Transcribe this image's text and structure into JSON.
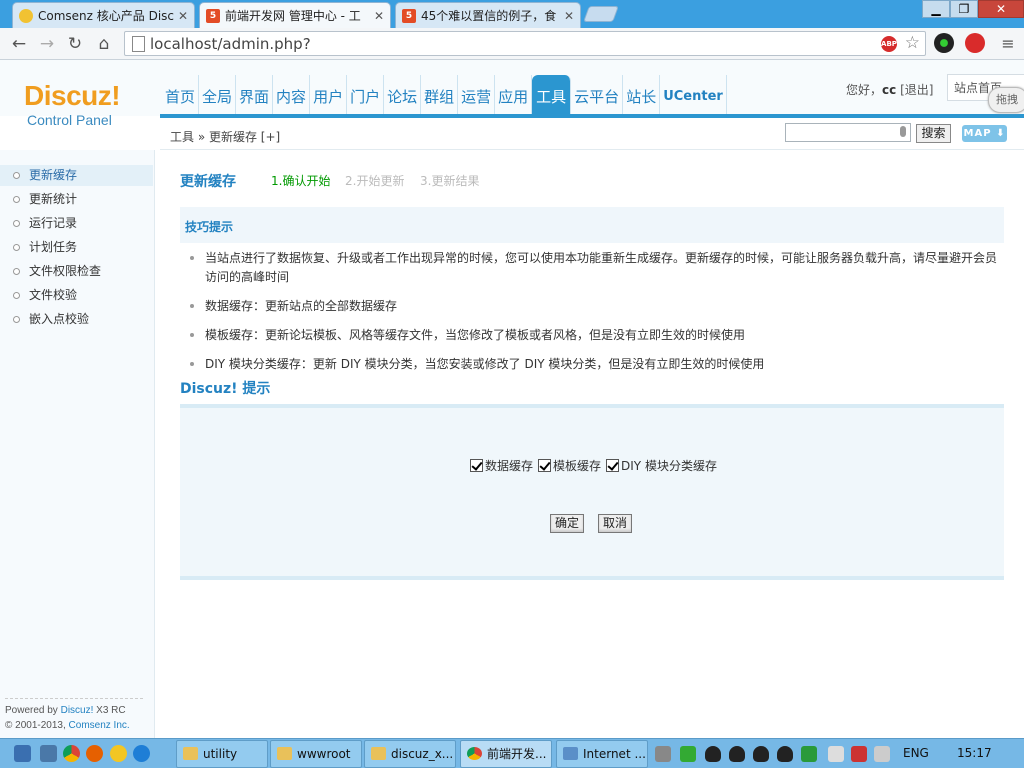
{
  "browser": {
    "tabs": [
      {
        "title": "Comsenz 核心产品 Discu",
        "icon": "comsenz-favicon"
      },
      {
        "title": "前端开发网 管理中心 - 工",
        "icon": "html5-favicon"
      },
      {
        "title": "45个难以置信的例子，食",
        "icon": "html5-favicon"
      }
    ],
    "close_glyph": "✕",
    "url": "localhost/admin.php?",
    "abp_label": "ABP"
  },
  "header": {
    "logo": "Discuz!",
    "logo_sub": "Control Panel",
    "nav": [
      "首页",
      "全局",
      "界面",
      "内容",
      "用户",
      "门户",
      "论坛",
      "群组",
      "运营",
      "应用",
      "工具",
      "云平台",
      "站长",
      "UCenter"
    ],
    "active_nav": "工具",
    "greeting_prefix": "您好，",
    "username": "cc",
    "logout": "[退出]",
    "site_home": "站点首页",
    "drag_label": "拖拽"
  },
  "subbar": {
    "breadcrumb": "工具 » 更新缓存  [+]",
    "search_button": "搜索",
    "map_button": "MAP"
  },
  "sidebar": {
    "items": [
      "更新缓存",
      "更新统计",
      "运行记录",
      "计划任务",
      "文件权限检查",
      "文件校验",
      "嵌入点校验"
    ],
    "active": "更新缓存"
  },
  "footer": {
    "powered_prefix": "Powered by ",
    "product": "Discuz!",
    "version": " X3 RC",
    "copyright_prefix": "© 2001-2013, ",
    "company": "Comsenz Inc."
  },
  "main": {
    "title": "更新缓存",
    "steps": [
      "1.确认开始",
      "2.开始更新",
      "3.更新结果"
    ],
    "tips_title": "技巧提示",
    "tips": [
      "当站点进行了数据恢复、升级或者工作出现异常的时候，您可以使用本功能重新生成缓存。更新缓存的时候，可能让服务器负载升高，请尽量避开会员访问的高峰时间",
      "数据缓存：更新站点的全部数据缓存",
      "模板缓存：更新论坛模板、风格等缓存文件，当您修改了模板或者风格，但是没有立即生效的时候使用",
      "DIY 模块分类缓存：更新 DIY 模块分类，当您安装或修改了 DIY 模块分类，但是没有立即生效的时候使用"
    ],
    "notice_title": "Discuz! 提示",
    "checkboxes": [
      {
        "label": "数据缓存",
        "checked": true
      },
      {
        "label": "模板缓存",
        "checked": true
      },
      {
        "label": "DIY 模块分类缓存",
        "checked": true
      }
    ],
    "confirm_button": "确定",
    "cancel_button": "取消"
  },
  "taskbar": {
    "tasks": [
      "utility",
      "wwwroot",
      "discuz_x...",
      "前端开发...",
      "Internet ..."
    ],
    "language": "ENG",
    "time": "15:17"
  },
  "colors": {
    "accent": "#2b96d0",
    "link": "#2382c1",
    "logo": "#f09d1f",
    "step_current": "#009900"
  }
}
